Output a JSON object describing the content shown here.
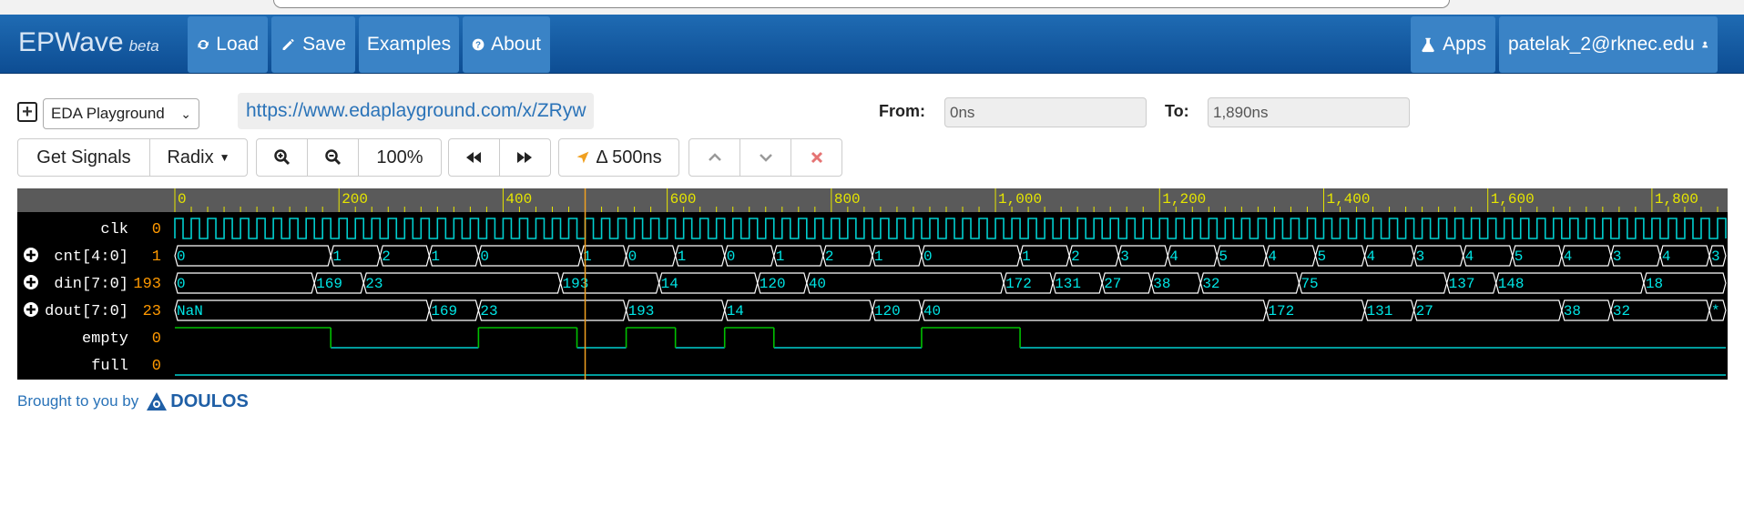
{
  "app": {
    "brand": "EPWave",
    "brand_beta": "beta"
  },
  "nav": {
    "load": "Load",
    "save": "Save",
    "examples": "Examples",
    "about": "About",
    "apps": "Apps",
    "user": "patelak_2@rknec.edu"
  },
  "toolbar": {
    "source_select": "EDA Playground",
    "url": "https://www.edaplayground.com/x/ZRyw",
    "from_label": "From:",
    "from_value": "0ns",
    "to_label": "To:",
    "to_value": "1,890ns",
    "get_signals": "Get Signals",
    "radix": "Radix",
    "zoom": "100%",
    "cursor_delta": "Δ 500ns"
  },
  "footer": {
    "text": "Brought to you by",
    "logo": "DOULOS"
  },
  "colors": {
    "nav_bg": "#1a62a8",
    "nav_button": "#3a83c6",
    "wave_bg": "#000000",
    "wave_line": "#00d0d0",
    "wave_text": "#00e5e5",
    "empty_line": "#00c000",
    "cursor": "#f0a020",
    "ruler_bg": "#5a5a5a",
    "ruler_tick": "#e6e600",
    "signal_value": "#ff9900"
  },
  "waveform": {
    "time_start_ns": 0,
    "time_end_ns": 1890,
    "cursor_ns": 500,
    "ruler_labels": [
      "0",
      "200",
      "400",
      "600",
      "800",
      "1,000",
      "1,200",
      "1,400",
      "1,600",
      "1,800"
    ],
    "clock_period_ns": 20,
    "signals": [
      {
        "name": "clk",
        "value": "0",
        "expandable": false,
        "type": "clock"
      },
      {
        "name": "cnt[4:0]",
        "value": "1",
        "expandable": true,
        "type": "bus",
        "segments": [
          [
            0,
            "0"
          ],
          [
            190,
            "1"
          ],
          [
            250,
            "2"
          ],
          [
            310,
            "1"
          ],
          [
            370,
            "0"
          ],
          [
            495,
            "1"
          ],
          [
            550,
            "0"
          ],
          [
            610,
            "1"
          ],
          [
            670,
            "0"
          ],
          [
            730,
            "1"
          ],
          [
            790,
            "2"
          ],
          [
            850,
            "1"
          ],
          [
            910,
            "0"
          ],
          [
            1030,
            "1"
          ],
          [
            1090,
            "2"
          ],
          [
            1150,
            "3"
          ],
          [
            1210,
            "4"
          ],
          [
            1270,
            "5"
          ],
          [
            1330,
            "4"
          ],
          [
            1390,
            "5"
          ],
          [
            1450,
            "4"
          ],
          [
            1510,
            "3"
          ],
          [
            1570,
            "4"
          ],
          [
            1630,
            "5"
          ],
          [
            1690,
            "4"
          ],
          [
            1750,
            "3"
          ],
          [
            1810,
            "4"
          ],
          [
            1870,
            "3"
          ]
        ]
      },
      {
        "name": "din[7:0]",
        "value": "193",
        "expandable": true,
        "type": "bus",
        "segments": [
          [
            0,
            "0"
          ],
          [
            170,
            "169"
          ],
          [
            230,
            "23"
          ],
          [
            470,
            "193"
          ],
          [
            590,
            "14"
          ],
          [
            710,
            "120"
          ],
          [
            770,
            "40"
          ],
          [
            1010,
            "172"
          ],
          [
            1070,
            "131"
          ],
          [
            1130,
            "27"
          ],
          [
            1190,
            "38"
          ],
          [
            1250,
            "32"
          ],
          [
            1370,
            "75"
          ],
          [
            1550,
            "137"
          ],
          [
            1610,
            "148"
          ],
          [
            1790,
            "18"
          ]
        ]
      },
      {
        "name": "dout[7:0]",
        "value": "23",
        "expandable": true,
        "type": "bus",
        "segments": [
          [
            0,
            "NaN"
          ],
          [
            310,
            "169"
          ],
          [
            370,
            "23"
          ],
          [
            550,
            "193"
          ],
          [
            670,
            "14"
          ],
          [
            850,
            "120"
          ],
          [
            910,
            "40"
          ],
          [
            1330,
            "172"
          ],
          [
            1450,
            "131"
          ],
          [
            1510,
            "27"
          ],
          [
            1690,
            "38"
          ],
          [
            1750,
            "32"
          ],
          [
            1870,
            "*"
          ]
        ]
      },
      {
        "name": "empty",
        "value": "0",
        "expandable": false,
        "type": "bit",
        "levels": [
          [
            0,
            1
          ],
          [
            190,
            0
          ],
          [
            370,
            1
          ],
          [
            490,
            0
          ],
          [
            550,
            1
          ],
          [
            610,
            0
          ],
          [
            670,
            1
          ],
          [
            730,
            0
          ],
          [
            910,
            1
          ],
          [
            1030,
            0
          ]
        ]
      },
      {
        "name": "full",
        "value": "0",
        "expandable": false,
        "type": "bit",
        "levels": [
          [
            0,
            0
          ]
        ]
      }
    ]
  }
}
